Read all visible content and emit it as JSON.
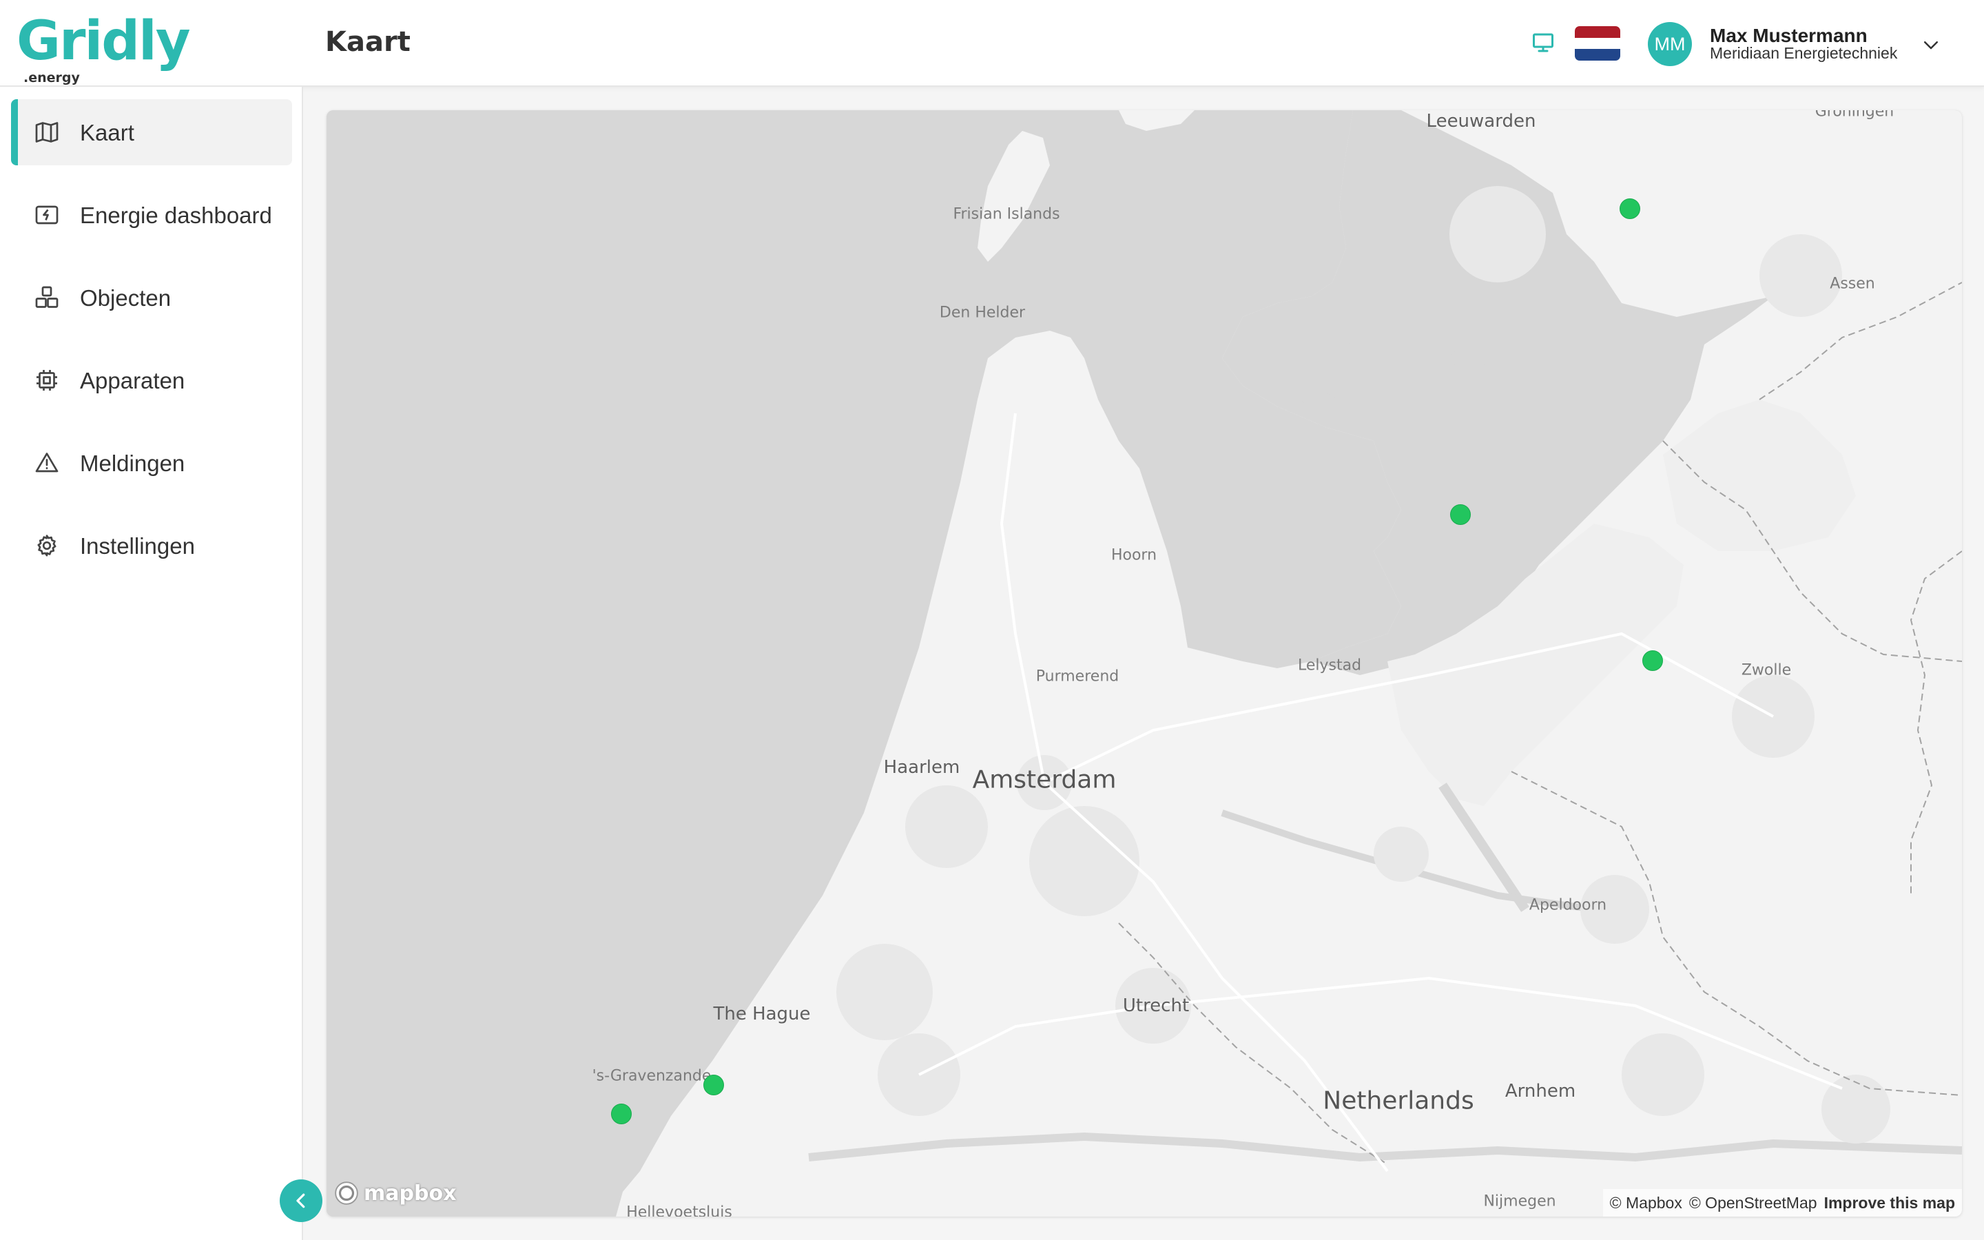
{
  "brand": {
    "name": "Gridly",
    "suffix": ".energy",
    "color": "#2cb9b0"
  },
  "header": {
    "title": "Kaart",
    "user": {
      "initials": "MM",
      "name": "Max Mustermann",
      "organization": "Meridiaan Energietechniek"
    },
    "language_flag": {
      "icon": "netherlands-flag",
      "colors": [
        "#ae1c28",
        "#ffffff",
        "#21468b"
      ]
    }
  },
  "sidebar": {
    "items": [
      {
        "label": "Kaart",
        "icon": "map-icon",
        "active": true
      },
      {
        "label": "Energie dashboard",
        "icon": "energy-dashboard-icon",
        "active": false
      },
      {
        "label": "Objecten",
        "icon": "objects-icon",
        "active": false
      },
      {
        "label": "Apparaten",
        "icon": "chip-icon",
        "active": false
      },
      {
        "label": "Meldingen",
        "icon": "warning-icon",
        "active": false
      },
      {
        "label": "Instellingen",
        "icon": "gear-icon",
        "active": false
      }
    ]
  },
  "map": {
    "labels": [
      "Leeuwarden",
      "Groningen",
      "Frisian Islands",
      "Den Helder",
      "Assen",
      "Hoorn",
      "Purmerend",
      "Lelystad",
      "Zwolle",
      "Haarlem",
      "Amsterdam",
      "Apeldoorn",
      "The Hague",
      "Utrecht",
      "'s-Gravenzande",
      "Netherlands",
      "Arnhem",
      "Nijmegen",
      "Hellevoetsluis"
    ],
    "marker_color": "#22c55e",
    "attribution": {
      "mapbox": "© Mapbox",
      "osm": "© OpenStreetMap",
      "improve": "Improve this map"
    },
    "logo": "mapbox"
  }
}
